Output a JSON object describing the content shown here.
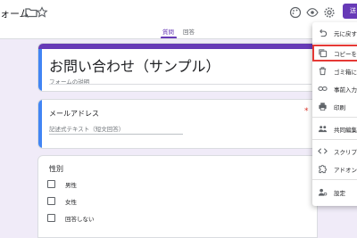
{
  "header": {
    "doc_title": "ォーム",
    "send_label": "送"
  },
  "tabs": [
    {
      "label": "質問",
      "active": true
    },
    {
      "label": "回答",
      "active": false
    }
  ],
  "form": {
    "title": "お問い合わせ（サンプル）",
    "description_placeholder": "フォームの説明"
  },
  "questions": {
    "email": {
      "label": "メールアドレス",
      "required_mark": "*",
      "placeholder": "記述式テキスト（短文回答）"
    },
    "gender": {
      "label": "性別",
      "options": [
        "男性",
        "女性",
        "回答しない"
      ]
    }
  },
  "menu": {
    "items": [
      {
        "label": "元に戻す",
        "icon": "undo-icon"
      },
      {
        "label": "コピーを作",
        "icon": "copy-icon"
      },
      {
        "label": "ゴミ箱に移",
        "icon": "trash-icon"
      },
      {
        "label": "事前入力し",
        "icon": "link-icon"
      },
      {
        "label": "印刷",
        "icon": "print-icon"
      },
      {
        "label": "共同編集者",
        "icon": "people-icon"
      },
      {
        "label": "スクリプト",
        "icon": "code-icon"
      },
      {
        "label": "アドオン",
        "icon": "puzzle-icon"
      },
      {
        "label": "設定",
        "icon": "settings-icon"
      }
    ]
  },
  "colors": {
    "accent": "#673ab7",
    "focus_edge": "#4285f4",
    "background": "#f0ebf8",
    "highlight_box": "#e53935"
  }
}
